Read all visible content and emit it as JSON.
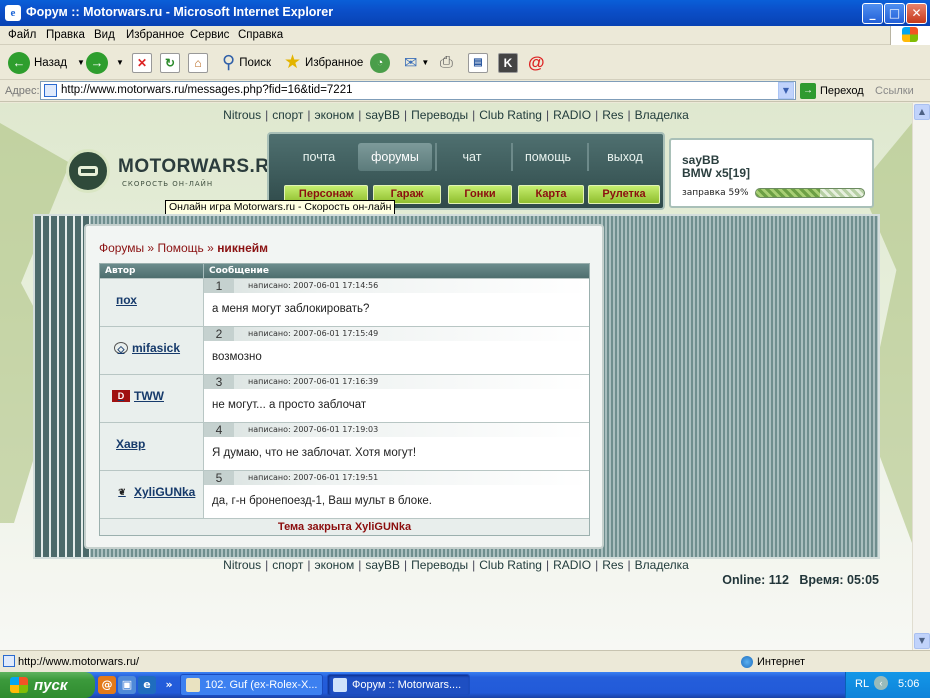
{
  "window": {
    "title": "Форум :: Motorwars.ru - Microsoft Internet Explorer",
    "app_icon": "ie-icon",
    "buttons": {
      "minimize": "_",
      "maximize": "□",
      "close": "✕"
    }
  },
  "menu": [
    "Файл",
    "Правка",
    "Вид",
    "Избранное",
    "Сервис",
    "Справка"
  ],
  "toolbar": {
    "back": "Назад",
    "search": "Поиск",
    "favorites": "Избранное"
  },
  "address": {
    "label": "Адрес:",
    "url": "http://www.motorwars.ru/messages.php?fid=16&tid=7221",
    "go": "Переход",
    "links": "Ссылки"
  },
  "site": {
    "nav": [
      "Nitrous",
      "спорт",
      "эконом",
      "sayBB",
      "Переводы",
      "Club Rating",
      "RADIO",
      "Res",
      "Владелка"
    ],
    "logo": {
      "name": "MOTORWARS.RU",
      "slogan": "СКОРОСТЬ ОН-ЛАЙН"
    },
    "tooltip": "Онлайн игра Motorwars.ru - Скорость он-лайн",
    "main_menu": [
      "почта",
      "форумы",
      "чат",
      "помощь",
      "выход"
    ],
    "active_menu": "форумы",
    "game_buttons": [
      "Персонаж",
      "Гараж",
      "Гонки",
      "Карта",
      "Рулетка"
    ],
    "user": {
      "name": "sayBB",
      "car": "BMW x5[19]",
      "fuel_label": "заправка 59%",
      "fuel_percent": 59
    },
    "breadcrumb": {
      "forums": "Форумы",
      "sep1": "»",
      "section": "Помощь",
      "sep2": "»",
      "topic": "никнейм"
    },
    "table_headers": {
      "author": "Автор",
      "message": "Сообщение"
    },
    "posts": [
      {
        "num": "1",
        "author": "пох",
        "date": "написано: 2007-06-01 17:14:56",
        "text": "а меня могут заблокировать?",
        "icon": ""
      },
      {
        "num": "2",
        "author": "mifasick",
        "date": "написано: 2007-06-01 17:15:49",
        "text": "возмозно",
        "icon": "mazda-icon"
      },
      {
        "num": "3",
        "author": "TWW",
        "date": "написано: 2007-06-01 17:16:39",
        "text": "не могут... а просто заблочат",
        "icon": "clan-d-icon"
      },
      {
        "num": "4",
        "author": "Хавр",
        "date": "написано: 2007-06-01 17:19:03",
        "text": "Я думаю, что не заблочат. Хотя могут!",
        "icon": ""
      },
      {
        "num": "5",
        "author": "XyliGUNka",
        "date": "написано: 2007-06-01 17:19:51",
        "text": "да, г-н бронепоезд-1, Ваш мульт в блоке.",
        "icon": "leaf-icon"
      }
    ],
    "footer_note": "Тема закрыта XyliGUNka",
    "online": "Online: 112",
    "time": "Время: 05:05"
  },
  "status": {
    "text": "http://www.motorwars.ru/",
    "zone": "Интернет"
  },
  "taskbar": {
    "start": "пуск",
    "tasks": [
      "102. Guf (ex-Rolex-X...",
      "Форум :: Motorwars...."
    ],
    "lang": "RL",
    "clock": "5:06"
  },
  "colors": {
    "accent": "#8b1212",
    "panel": "#4e6e6e",
    "button_green": "#a8d84a"
  }
}
